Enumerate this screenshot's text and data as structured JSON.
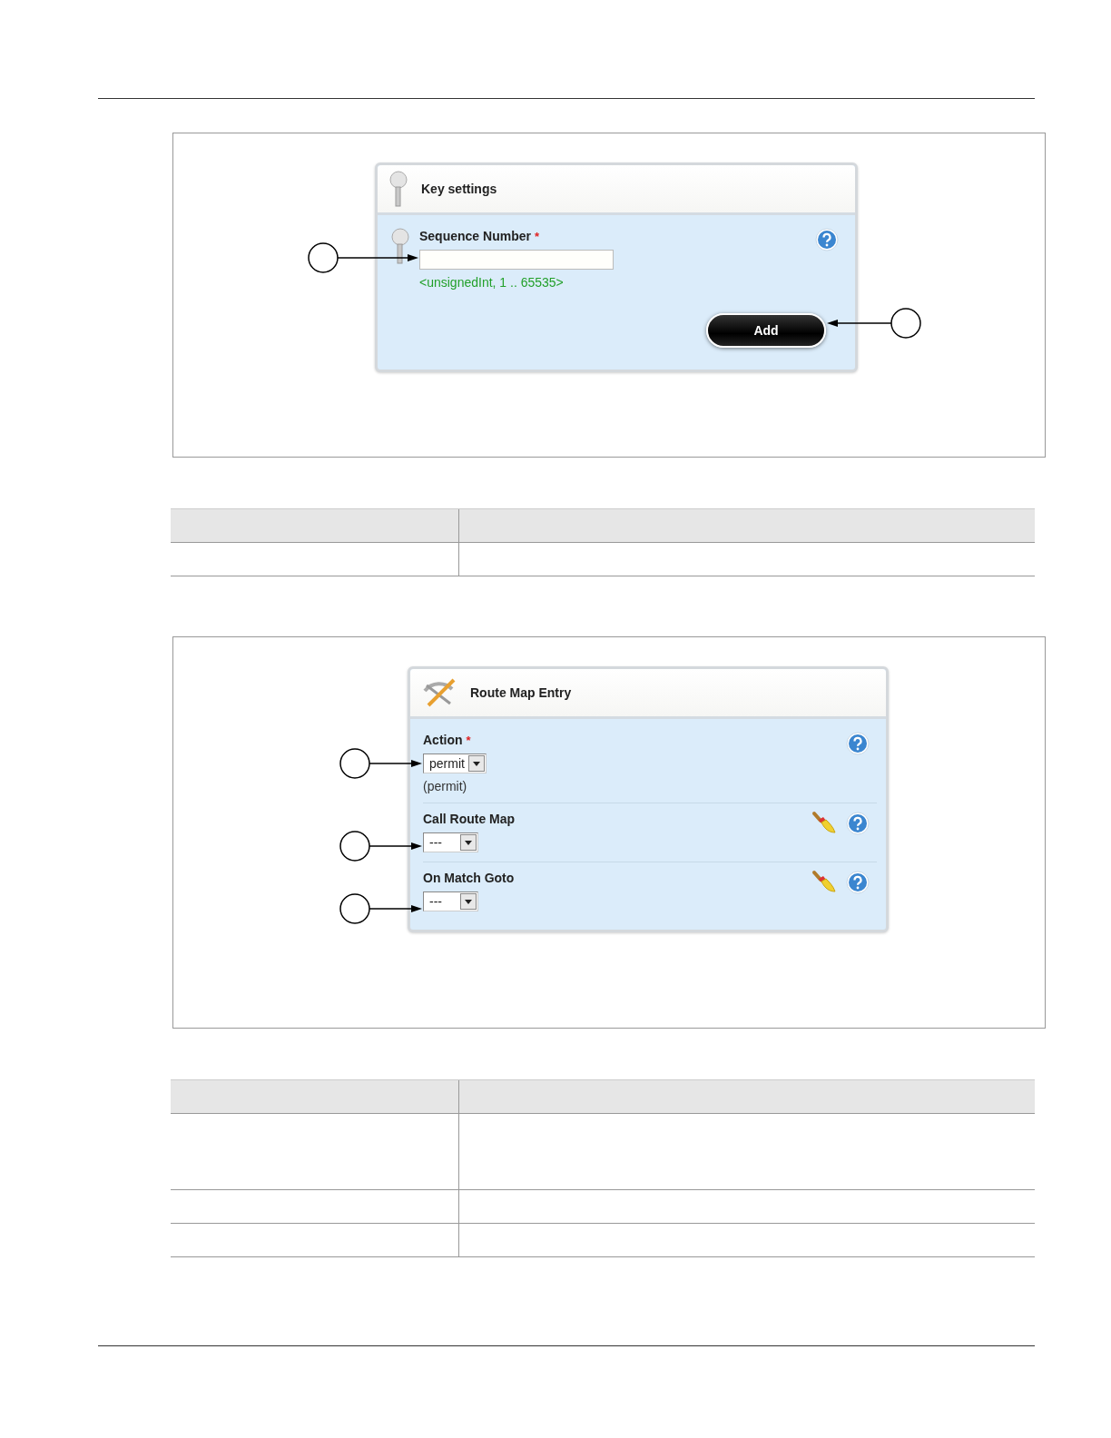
{
  "figures": [
    {
      "panel": {
        "title": "Key settings",
        "fields": [
          {
            "kind": "text",
            "label": "Sequence Number",
            "required_mark": "*",
            "clearable": false,
            "note": "<unsignedInt, 1 .. 65535>"
          }
        ],
        "button": {
          "label": "Add"
        }
      }
    },
    {
      "panel": {
        "title": "Route Map Entry",
        "fields": [
          {
            "kind": "select",
            "label": "Action",
            "required_mark": "*",
            "clearable": false,
            "value": "permit",
            "note": "(permit)"
          },
          {
            "kind": "select",
            "label": "Call Route Map",
            "clearable": true,
            "value": "---"
          },
          {
            "kind": "select",
            "label": "On Match Goto",
            "clearable": true,
            "value": "---"
          }
        ]
      }
    }
  ]
}
